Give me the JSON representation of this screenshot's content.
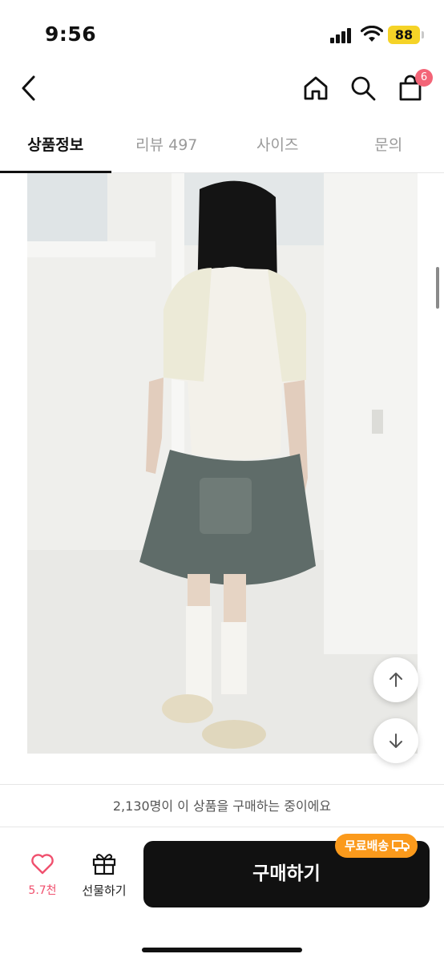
{
  "status_bar": {
    "time": "9:56",
    "battery": "88",
    "icons": [
      "signal-icon",
      "wifi-icon",
      "battery-icon"
    ]
  },
  "nav": {
    "icons": [
      "back-arrow-icon",
      "home-icon",
      "search-icon",
      "shopping-bag-icon"
    ],
    "cart_badge": "6"
  },
  "tabs": [
    {
      "label": "상품정보",
      "active": true
    },
    {
      "label": "리뷰 497",
      "active": false
    },
    {
      "label": "사이즈",
      "active": false
    },
    {
      "label": "문의",
      "active": false
    }
  ],
  "floating_buttons": {
    "icons": [
      "arrow-up-icon",
      "arrow-down-icon"
    ]
  },
  "banner": {
    "text": "2,130명이 이 상품을 구매하는 중이에요"
  },
  "actions": {
    "like_count": "5.7천",
    "gift_label": "선물하기",
    "buy_label": "구매하기",
    "free_shipping_badge": "무료배송",
    "icons": [
      "heart-icon",
      "gift-icon",
      "truck-icon"
    ]
  },
  "colors": {
    "accent_pink": "#f0506e",
    "badge_pink": "#f36477",
    "free_shipping_orange": "#fb9a1c",
    "battery_yellow": "#f5d327",
    "buy_button": "#111111"
  }
}
